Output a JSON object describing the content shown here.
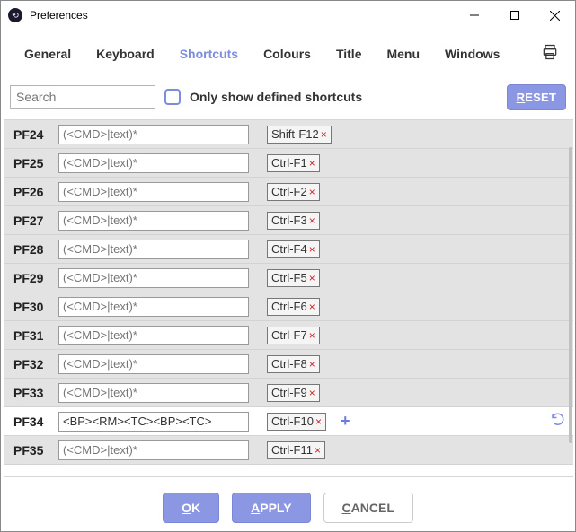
{
  "window": {
    "title": "Preferences"
  },
  "tabs": {
    "general": "General",
    "keyboard": "Keyboard",
    "shortcuts": "Shortcuts",
    "colours": "Colours",
    "title": "Title",
    "menu": "Menu",
    "windows": "Windows"
  },
  "filter": {
    "search_placeholder": "Search",
    "only_defined": "Only show defined shortcuts",
    "reset_head": "R",
    "reset_tail": "ESET"
  },
  "rows": [
    {
      "key": "PF24",
      "cmd_ph": "(<CMD>|text)*",
      "cmd_val": "",
      "shortcut": "Shift-F12",
      "active": false
    },
    {
      "key": "PF25",
      "cmd_ph": "(<CMD>|text)*",
      "cmd_val": "",
      "shortcut": "Ctrl-F1",
      "active": false
    },
    {
      "key": "PF26",
      "cmd_ph": "(<CMD>|text)*",
      "cmd_val": "",
      "shortcut": "Ctrl-F2",
      "active": false
    },
    {
      "key": "PF27",
      "cmd_ph": "(<CMD>|text)*",
      "cmd_val": "",
      "shortcut": "Ctrl-F3",
      "active": false
    },
    {
      "key": "PF28",
      "cmd_ph": "(<CMD>|text)*",
      "cmd_val": "",
      "shortcut": "Ctrl-F4",
      "active": false
    },
    {
      "key": "PF29",
      "cmd_ph": "(<CMD>|text)*",
      "cmd_val": "",
      "shortcut": "Ctrl-F5",
      "active": false
    },
    {
      "key": "PF30",
      "cmd_ph": "(<CMD>|text)*",
      "cmd_val": "",
      "shortcut": "Ctrl-F6",
      "active": false
    },
    {
      "key": "PF31",
      "cmd_ph": "(<CMD>|text)*",
      "cmd_val": "",
      "shortcut": "Ctrl-F7",
      "active": false
    },
    {
      "key": "PF32",
      "cmd_ph": "(<CMD>|text)*",
      "cmd_val": "",
      "shortcut": "Ctrl-F8",
      "active": false
    },
    {
      "key": "PF33",
      "cmd_ph": "(<CMD>|text)*",
      "cmd_val": "",
      "shortcut": "Ctrl-F9",
      "active": false
    },
    {
      "key": "PF34",
      "cmd_ph": "(<CMD>|text)*",
      "cmd_val": "<BP><RM><TC><BP><TC>",
      "shortcut": "Ctrl-F10",
      "active": true
    },
    {
      "key": "PF35",
      "cmd_ph": "(<CMD>|text)*",
      "cmd_val": "",
      "shortcut": "Ctrl-F11",
      "active": false
    }
  ],
  "footer": {
    "ok_head": "O",
    "ok_tail": "K",
    "apply_head": "A",
    "apply_tail": "PPLY",
    "cancel_head": "C",
    "cancel_tail": "ANCEL"
  },
  "icons": {
    "clear": "×",
    "add": "+"
  }
}
